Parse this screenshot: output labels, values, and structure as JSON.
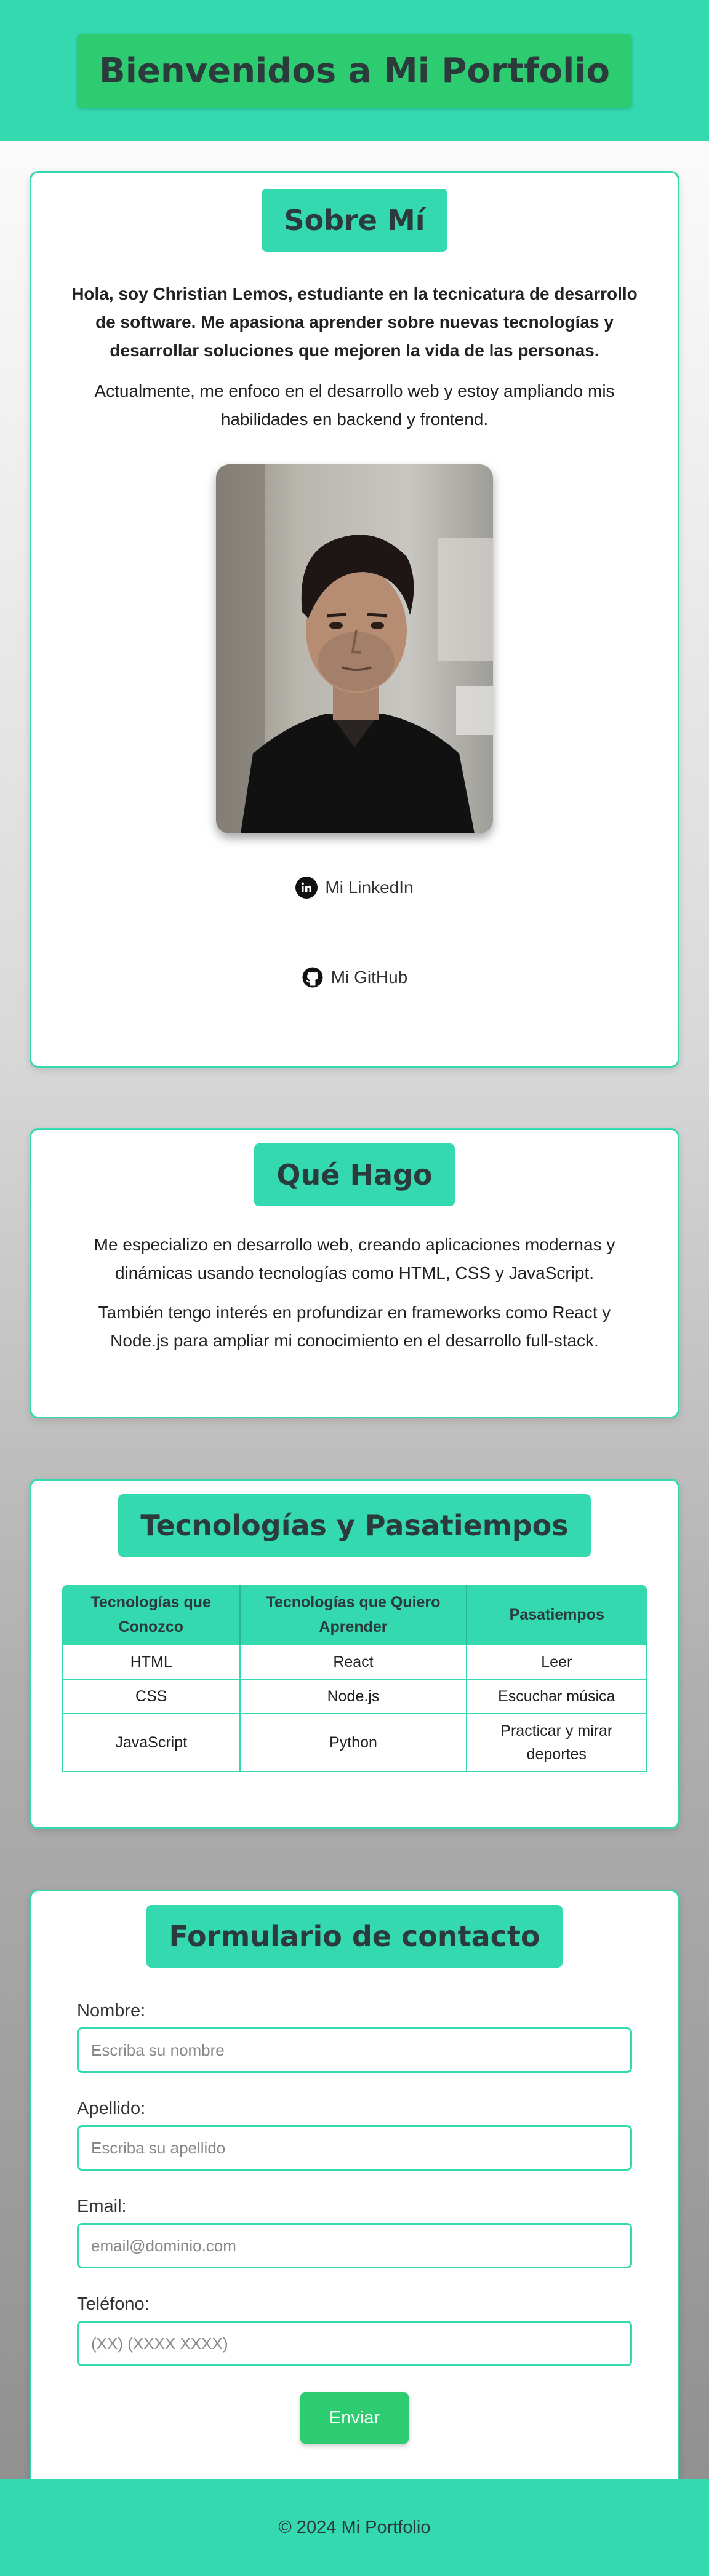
{
  "header": {
    "title": "Bienvenidos a Mi Portfolio"
  },
  "about": {
    "title": "Sobre Mí",
    "intro": "Hola, soy Christian Lemos, estudiante en la tecnicatura de desarrollo de software. Me apasiona aprender sobre nuevas tecnologías y desarrollar soluciones que mejoren la vida de las personas.",
    "focus": "Actualmente, me enfoco en el desarrollo web y estoy ampliando mis habilidades en backend y frontend.",
    "links": {
      "linkedin": {
        "label": "Mi LinkedIn",
        "icon": "linkedin-icon"
      },
      "github": {
        "label": "Mi GitHub",
        "icon": "github-icon"
      }
    }
  },
  "whatido": {
    "title": "Qué Hago",
    "p1": "Me especializo en desarrollo web, creando aplicaciones modernas y dinámicas usando tecnologías como HTML, CSS y JavaScript.",
    "p2": "También tengo interés en profundizar en frameworks como React y Node.js para ampliar mi conocimiento en el desarrollo full-stack."
  },
  "tech": {
    "title": "Tecnologías y Pasatiempos",
    "headers": [
      "Tecnologías que Conozco",
      "Tecnologías que Quiero Aprender",
      "Pasatiempos"
    ],
    "rows": [
      [
        "HTML",
        "React",
        "Leer"
      ],
      [
        "CSS",
        "Node.js",
        "Escuchar música"
      ],
      [
        "JavaScript",
        "Python",
        "Practicar y mirar deportes"
      ]
    ]
  },
  "contact": {
    "title": "Formulario de contacto",
    "fields": [
      {
        "label": "Nombre:",
        "placeholder": "Escriba su nombre"
      },
      {
        "label": "Apellido:",
        "placeholder": "Escriba su apellido"
      },
      {
        "label": "Email:",
        "placeholder": "email@dominio.com"
      },
      {
        "label": "Teléfono:",
        "placeholder": "(XX) (XXXX XXXX)"
      }
    ],
    "submit": "Enviar"
  },
  "footer": {
    "text": "© 2024 Mi Portfolio"
  },
  "colors": {
    "accent": "#34d9b0",
    "button": "#2ecc71",
    "heading_text": "#2b3a3a"
  }
}
